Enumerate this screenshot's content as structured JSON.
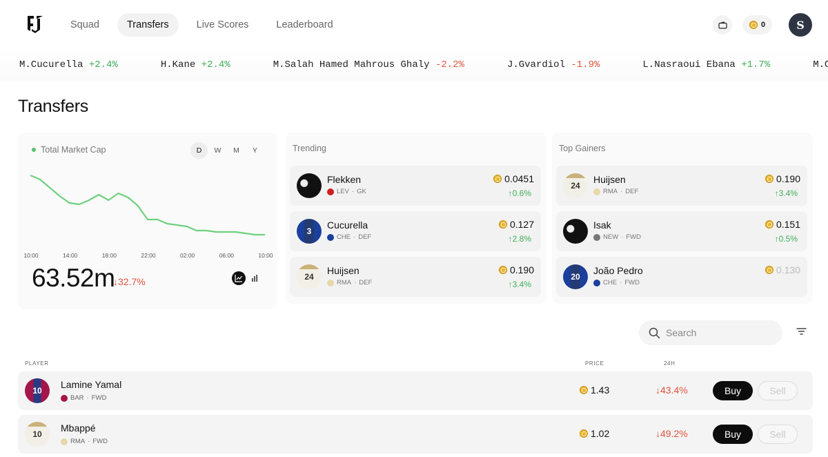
{
  "nav": {
    "items": [
      {
        "label": "Squad",
        "active": false
      },
      {
        "label": "Transfers",
        "active": true
      },
      {
        "label": "Live Scores",
        "active": false
      },
      {
        "label": "Leaderboard",
        "active": false
      }
    ],
    "coin_balance": "0",
    "avatar_initial": "S",
    "icons": [
      "logo",
      "wallet-icon",
      "coin-icon"
    ]
  },
  "ticker": [
    {
      "name": "M.Cucurella",
      "change": "+2.4%",
      "dir": "up"
    },
    {
      "name": "H.Kane",
      "change": "+2.4%",
      "dir": "up"
    },
    {
      "name": "M.Salah Hamed Mahrous Ghaly",
      "change": "-2.2%",
      "dir": "down"
    },
    {
      "name": "J.Gvardiol",
      "change": "-1.9%",
      "dir": "down"
    },
    {
      "name": "L.Nasraoui Ebana",
      "change": "+1.7%",
      "dir": "up"
    },
    {
      "name": "M.Ol",
      "change": "",
      "dir": "up"
    }
  ],
  "page_title": "Transfers",
  "market": {
    "label": "Total Market Cap",
    "ranges": [
      "D",
      "W",
      "M",
      "Y"
    ],
    "active_range": "D",
    "value": "63.52m",
    "change": "↓32.7%",
    "colors": {
      "line": "#6fd07f",
      "down": "#e0533b",
      "up": "#3fae58"
    }
  },
  "chart_data": {
    "type": "line",
    "title": "Total Market Cap",
    "x_ticks": [
      "10:00",
      "14:00",
      "18:00",
      "22:00",
      "02:00",
      "06:00",
      "10:00"
    ],
    "x": [
      0,
      1,
      2,
      3,
      4,
      5,
      6,
      7,
      8,
      9,
      10,
      11,
      12,
      13,
      14,
      15,
      16,
      17,
      18,
      19,
      20,
      21,
      22,
      23,
      24
    ],
    "values": [
      100,
      97,
      91,
      85,
      80,
      79,
      82,
      86,
      82,
      87,
      84,
      78,
      68,
      68,
      65,
      64,
      63,
      60,
      60,
      59,
      59,
      59,
      58,
      57,
      57
    ],
    "grid": false,
    "legend": "none"
  },
  "trending": {
    "title": "Trending",
    "items": [
      {
        "name": "Flekken",
        "club": "LEV",
        "pos": "GK",
        "price": "0.0451",
        "change": "↑0.6%",
        "dir": "up",
        "shirt": "dark",
        "number": "",
        "club_color": "#d01f1f"
      },
      {
        "name": "Cucurella",
        "club": "CHE",
        "pos": "DEF",
        "price": "0.127",
        "change": "↑2.8%",
        "dir": "up",
        "shirt": "che",
        "number": "3",
        "club_color": "#1b3f9c"
      },
      {
        "name": "Huijsen",
        "club": "RMA",
        "pos": "DEF",
        "price": "0.190",
        "change": "↑3.4%",
        "dir": "up",
        "shirt": "rma",
        "number": "24",
        "club_color": "#e6d8a8"
      }
    ]
  },
  "gainers": {
    "title": "Top Gainers",
    "items": [
      {
        "name": "Huijsen",
        "club": "RMA",
        "pos": "DEF",
        "price": "0.190",
        "change": "↑3.4%",
        "dir": "up",
        "shirt": "rma",
        "number": "24",
        "club_color": "#e6d8a8"
      },
      {
        "name": "Isak",
        "club": "NEW",
        "pos": "FWD",
        "price": "0.151",
        "change": "↑0.5%",
        "dir": "up",
        "shirt": "dark",
        "number": "",
        "club_color": "#777777"
      },
      {
        "name": "João Pedro",
        "club": "CHE",
        "pos": "FWD",
        "price": "0.130",
        "change": "",
        "dir": "up",
        "shirt": "che",
        "number": "20",
        "club_color": "#1b3f9c",
        "faded": true
      }
    ]
  },
  "search": {
    "placeholder": "Search",
    "value": ""
  },
  "table": {
    "headers": {
      "player": "PLAYER",
      "price": "PRICE",
      "change": "24H"
    },
    "rows": [
      {
        "name": "Lamine Yamal",
        "club": "BAR",
        "pos": "FWD",
        "price": "1.43",
        "change": "↓43.4%",
        "dir": "down",
        "shirt": "bar",
        "number": "10",
        "club_color": "#a4154b",
        "buy": "Buy",
        "sell": "Sell"
      },
      {
        "name": "Mbappé",
        "club": "RMA",
        "pos": "FWD",
        "price": "1.02",
        "change": "↓49.2%",
        "dir": "down",
        "shirt": "rma",
        "number": "10",
        "club_color": "#e6d8a8",
        "buy": "Buy",
        "sell": "Sell"
      }
    ]
  }
}
